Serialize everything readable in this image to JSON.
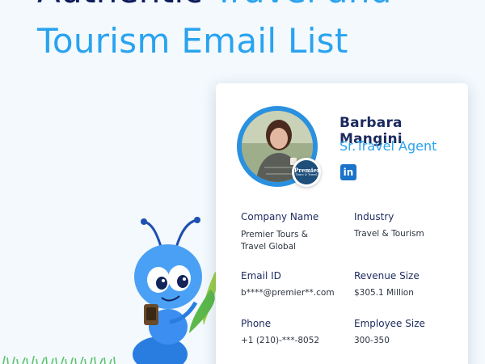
{
  "headline": {
    "line1_dark": "Authentic",
    "line1_blue": "Travel and",
    "line2": "Tourism Email List"
  },
  "profile": {
    "name": "Barbara Mangini",
    "title": "Sr.Travel Agent",
    "social_icon": "linkedin-icon",
    "company_logo_text_1": "Premier",
    "company_logo_text_2": "Tours & Travel"
  },
  "fields": {
    "company_name": {
      "label": "Company Name",
      "value": "Premier Tours & Travel Global"
    },
    "industry": {
      "label": "Industry",
      "value": "Travel & Tourism"
    },
    "email": {
      "label": "Email ID",
      "value": "b****@premier**.com"
    },
    "revenue": {
      "label": "Revenue Size",
      "value": "$305.1 Million"
    },
    "phone": {
      "label": "Phone",
      "value": "+1 (210)-***-8052"
    },
    "employees": {
      "label": "Employee Size",
      "value": "300-350"
    }
  },
  "colors": {
    "background": "#f3f9fd",
    "headline_dark": "#0d1b5a",
    "headline_blue": "#2aa3ef",
    "label": "#1b2a5e",
    "accent_ring": "#2a90e0",
    "linkedin": "#1a73c9"
  }
}
